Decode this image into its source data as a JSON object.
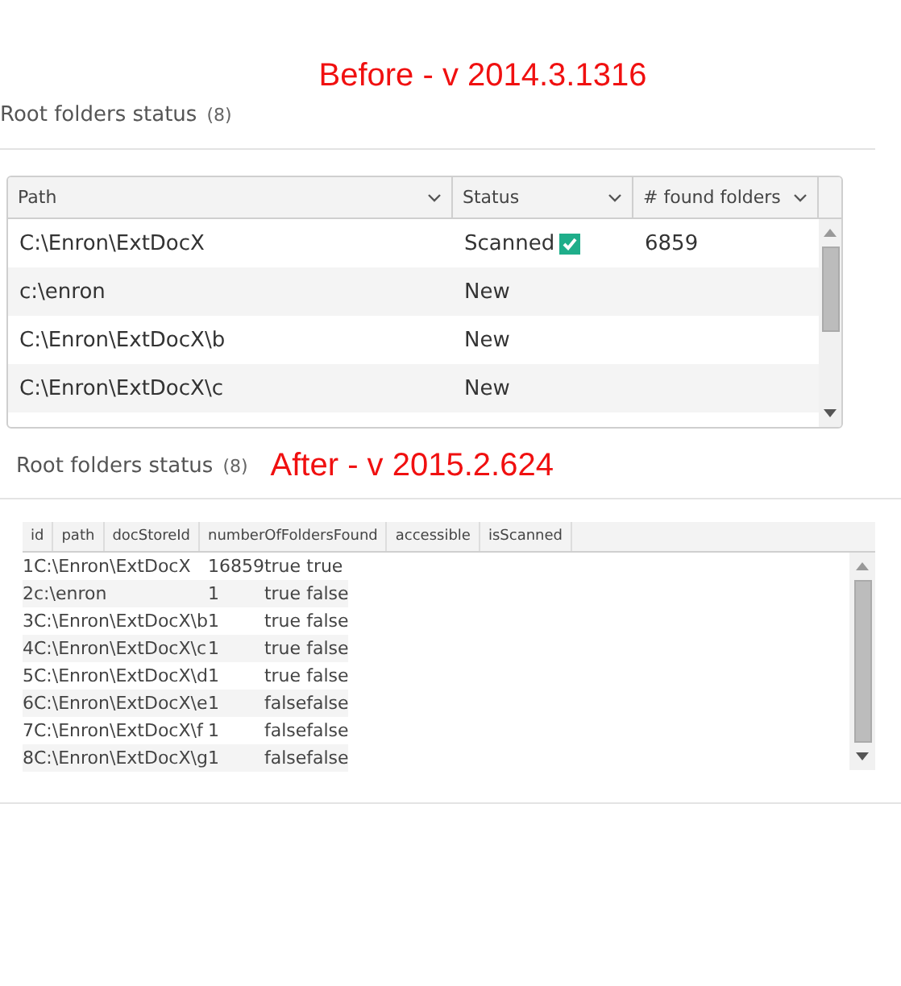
{
  "before": {
    "title": "Before - v 2014.3.1316",
    "heading": "Root folders status",
    "count": "(8)",
    "table": {
      "columns": [
        "Path",
        "Status",
        "# found folders"
      ],
      "rows": [
        {
          "path": "C:\\Enron\\ExtDocX",
          "status": "Scanned",
          "scanned": true,
          "found": "6859"
        },
        {
          "path": "c:\\enron",
          "status": "New",
          "scanned": false
        },
        {
          "path": "C:\\Enron\\ExtDocX\\b",
          "status": "New",
          "scanned": false
        },
        {
          "path": "C:\\Enron\\ExtDocX\\c",
          "status": "New",
          "scanned": false
        }
      ]
    }
  },
  "after": {
    "heading": "Root folders status",
    "count": "(8)",
    "title": "After - v 2015.2.624",
    "grid": {
      "header_labels": [
        "id",
        "path",
        "docStoreId",
        "numberOfFoldersFound",
        "accessible",
        "isScanned"
      ],
      "records": [
        {
          "id": "1",
          "path": "C:\\Enron\\ExtDocX",
          "doc_store_id": "1",
          "folders_found": "6859",
          "accessible": "true",
          "is_scanned": "true"
        },
        {
          "id": "2",
          "path": "c:\\enron",
          "doc_store_id": "1",
          "accessible": "true",
          "is_scanned": "false"
        },
        {
          "id": "3",
          "path": "C:\\Enron\\ExtDocX\\b",
          "doc_store_id": "1",
          "accessible": "true",
          "is_scanned": "false"
        },
        {
          "id": "4",
          "path": "C:\\Enron\\ExtDocX\\c",
          "doc_store_id": "1",
          "accessible": "true",
          "is_scanned": "false"
        },
        {
          "id": "5",
          "path": "C:\\Enron\\ExtDocX\\d",
          "doc_store_id": "1",
          "accessible": "true",
          "is_scanned": "false"
        },
        {
          "id": "6",
          "path": "C:\\Enron\\ExtDocX\\e",
          "doc_store_id": "1",
          "accessible": "false",
          "is_scanned": "false"
        },
        {
          "id": "7",
          "path": "C:\\Enron\\ExtDocX\\f",
          "doc_store_id": "1",
          "accessible": "false",
          "is_scanned": "false"
        },
        {
          "id": "8",
          "path": "C:\\Enron\\ExtDocX\\g",
          "doc_store_id": "1",
          "accessible": "false",
          "is_scanned": "false"
        }
      ]
    }
  }
}
